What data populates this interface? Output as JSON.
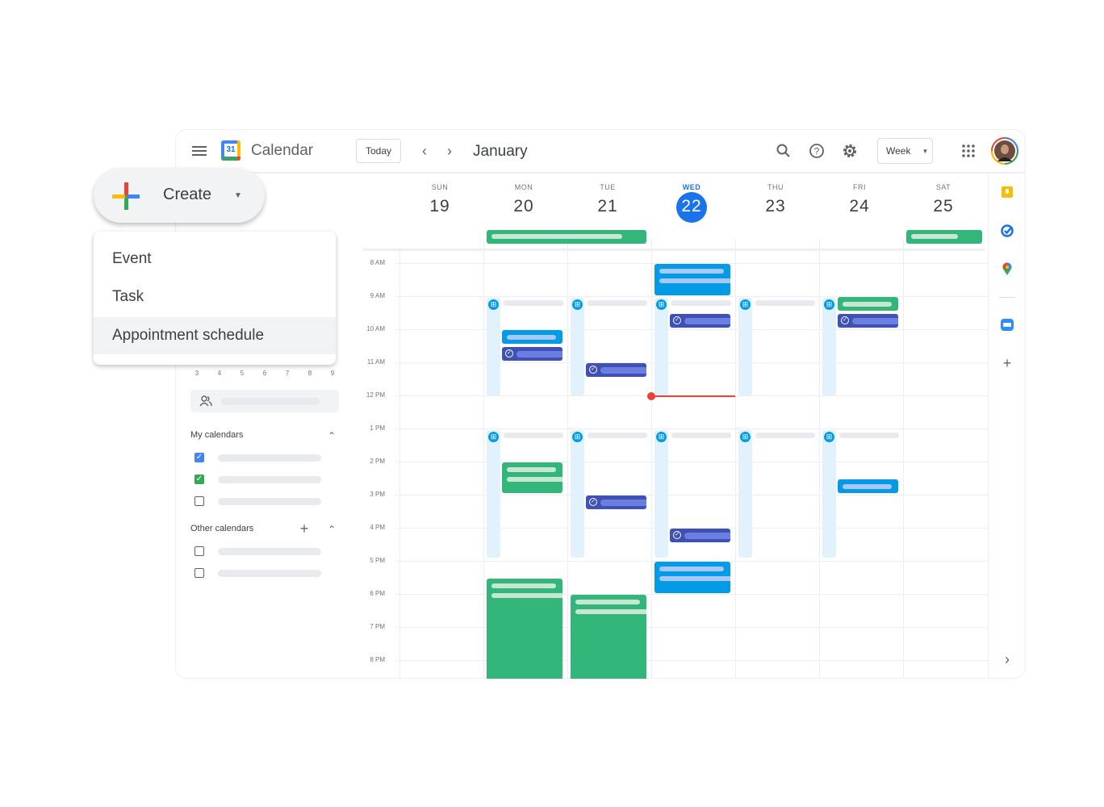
{
  "header": {
    "app_title": "Calendar",
    "logo_day": "31",
    "today_label": "Today",
    "month": "January",
    "view_label": "Week",
    "icons": [
      "menu-icon",
      "search-icon",
      "help-icon",
      "settings-icon",
      "apps-grid-icon",
      "avatar"
    ]
  },
  "create": {
    "label": "Create",
    "menu": [
      {
        "label": "Event"
      },
      {
        "label": "Task"
      },
      {
        "label": "Appointment schedule",
        "hovered": true
      }
    ]
  },
  "mini_calendar": {
    "row": [
      "3",
      "4",
      "5",
      "6",
      "7",
      "8",
      "9"
    ]
  },
  "sidebar": {
    "my_calendars": "My calendars",
    "other_calendars": "Other calendars",
    "my_items": [
      {
        "checked": true,
        "color": "#4285f4"
      },
      {
        "checked": true,
        "color": "#34a853"
      },
      {
        "checked": false
      }
    ],
    "other_items": [
      {
        "checked": false
      },
      {
        "checked": false
      }
    ]
  },
  "days": [
    {
      "dow": "SUN",
      "num": "19"
    },
    {
      "dow": "MON",
      "num": "20"
    },
    {
      "dow": "TUE",
      "num": "21"
    },
    {
      "dow": "WED",
      "num": "22",
      "today": true
    },
    {
      "dow": "THU",
      "num": "23"
    },
    {
      "dow": "FRI",
      "num": "24"
    },
    {
      "dow": "SAT",
      "num": "25"
    }
  ],
  "hours": [
    "8 AM",
    "9 AM",
    "10 AM",
    "11 AM",
    "12 PM",
    "1 PM",
    "2 PM",
    "3 PM",
    "4 PM",
    "5 PM",
    "6 PM",
    "7 PM",
    "8 PM"
  ],
  "colors": {
    "accent": "#1a73e8",
    "green": "#33b679",
    "blue": "#039be5",
    "task": "#3f51b5",
    "schedule": "#e1f2fd",
    "now": "#ea4335"
  },
  "all_day": [
    {
      "day": 1,
      "span": 2,
      "type": "green"
    },
    {
      "day": 6,
      "span": 1,
      "type": "green"
    }
  ],
  "schedules": [
    {
      "day": 1,
      "start": 9,
      "end": 12
    },
    {
      "day": 2,
      "start": 9,
      "end": 12
    },
    {
      "day": 3,
      "start": 9,
      "end": 12
    },
    {
      "day": 4,
      "start": 9,
      "end": 12
    },
    {
      "day": 5,
      "start": 9,
      "end": 12
    },
    {
      "day": 1,
      "start": 13,
      "end": 16.9
    },
    {
      "day": 2,
      "start": 13,
      "end": 16.9
    },
    {
      "day": 3,
      "start": 13,
      "end": 16.9
    },
    {
      "day": 4,
      "start": 13,
      "end": 16.9
    },
    {
      "day": 5,
      "start": 13,
      "end": 16.9
    }
  ],
  "events": [
    {
      "day": 3,
      "start": 8,
      "end": 8.97,
      "type": "blue"
    },
    {
      "day": 1,
      "start": 10,
      "end": 10.45,
      "type": "blue"
    },
    {
      "day": 1,
      "start": 10.5,
      "end": 10.95,
      "type": "task"
    },
    {
      "day": 2,
      "start": 11,
      "end": 11.45,
      "type": "task"
    },
    {
      "day": 3,
      "start": 9.5,
      "end": 9.95,
      "type": "task"
    },
    {
      "day": 5,
      "start": 9,
      "end": 9.45,
      "type": "green"
    },
    {
      "day": 5,
      "start": 9.5,
      "end": 9.95,
      "type": "task"
    },
    {
      "day": 1,
      "start": 14,
      "end": 14.95,
      "type": "green"
    },
    {
      "day": 2,
      "start": 15,
      "end": 15.45,
      "type": "task"
    },
    {
      "day": 3,
      "start": 16,
      "end": 16.45,
      "type": "task"
    },
    {
      "day": 5,
      "start": 14.5,
      "end": 14.95,
      "type": "blue"
    },
    {
      "day": 3,
      "start": 17,
      "end": 17.97,
      "type": "blue"
    },
    {
      "day": 1,
      "start": 17.5,
      "end": 20.6,
      "type": "green"
    },
    {
      "day": 2,
      "start": 18,
      "end": 20.6,
      "type": "green"
    }
  ],
  "now": {
    "day": 3,
    "time": 12
  }
}
